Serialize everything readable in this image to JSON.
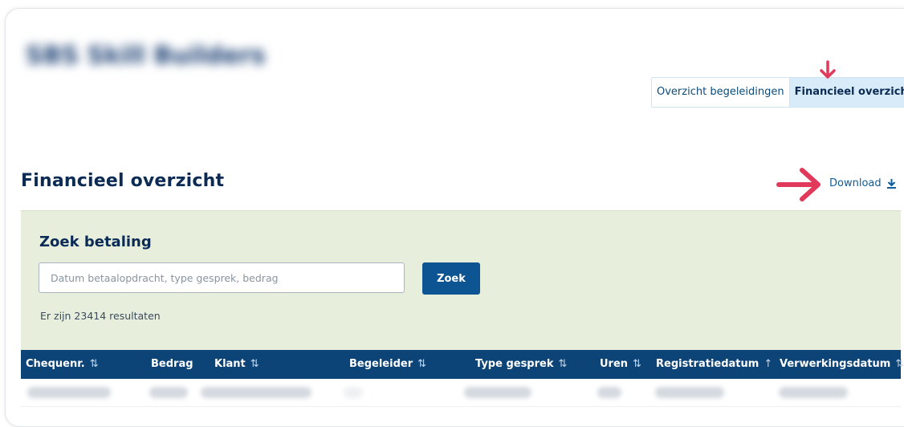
{
  "header": {
    "blurred_title": "SBS Skill Builders"
  },
  "tabs": [
    {
      "label": "Overzicht begeleidingen",
      "active": false
    },
    {
      "label": "Financieel overzicht",
      "active": true
    }
  ],
  "page": {
    "title": "Financieel overzicht",
    "download_label": "Download"
  },
  "search": {
    "title": "Zoek betaling",
    "placeholder": "Datum betaalopdracht, type gesprek, bedrag",
    "value": "",
    "button_label": "Zoek",
    "result_text": "Er zijn 23414 resultaten"
  },
  "table": {
    "columns": [
      {
        "label": "Chequenr.",
        "sort": "⇅"
      },
      {
        "label": "Bedrag",
        "sort": ""
      },
      {
        "label": "Klant",
        "sort": "⇅"
      },
      {
        "label": "Begeleider",
        "sort": "⇅"
      },
      {
        "label": "Type gesprek",
        "sort": "⇅"
      },
      {
        "label": "Uren",
        "sort": "⇅"
      },
      {
        "label": "Registratiedatum",
        "sort": "↑"
      },
      {
        "label": "Verwerkingsdatum",
        "sort": "⇅"
      }
    ]
  },
  "colors": {
    "primary": "#0c5592",
    "header_bg": "#0c4478",
    "panel_bg": "#e8eedc",
    "annotation_arrow": "#e0395a"
  },
  "icons": {
    "download": "download-icon",
    "annotation_down": "arrow-down-annotation",
    "annotation_right": "arrow-right-annotation"
  }
}
